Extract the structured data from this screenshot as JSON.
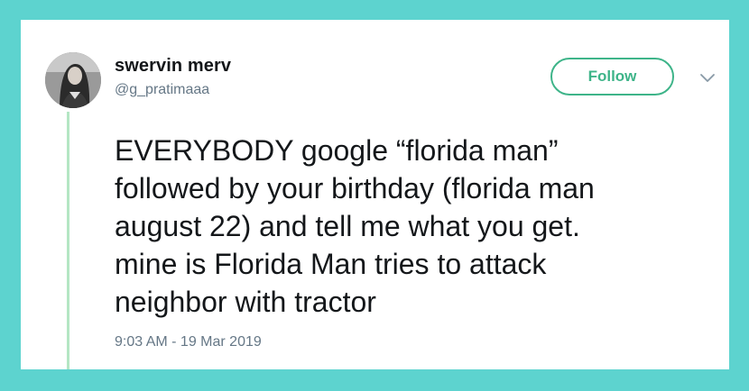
{
  "user": {
    "display_name": "swervin merv",
    "handle": "@g_pratimaaa"
  },
  "actions": {
    "follow_label": "Follow"
  },
  "tweet": {
    "text": "EVERYBODY google “florida man”\nfollowed by your birthday (florida man\naugust 22) and tell me what you get.\nmine is Florida Man tries to attack\nneighbor with tractor",
    "timestamp": "9:03 AM - 19 Mar 2019"
  },
  "icons": {
    "avatar": "profile-photo",
    "menu": "chevron-down-icon"
  },
  "colors": {
    "background": "#5dd3cf",
    "card": "#ffffff",
    "accent": "#3eb489",
    "thread_line": "#b4e6c4",
    "primary_text": "#14171a",
    "secondary_text": "#657786"
  }
}
